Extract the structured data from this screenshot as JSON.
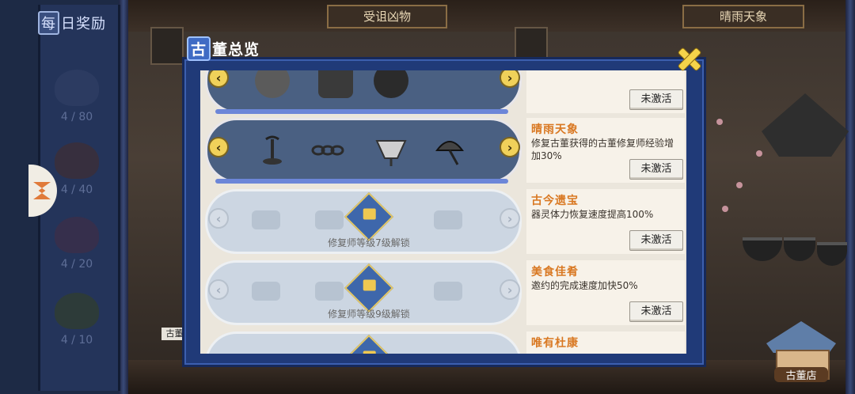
{
  "top_signs": {
    "left": "受诅凶物",
    "right": "晴雨天象"
  },
  "daily_reward": {
    "badge": "每",
    "title": "日奖励",
    "items": [
      {
        "count": "4 / 80"
      },
      {
        "count": "4 / 40"
      },
      {
        "count": "4 / 20"
      },
      {
        "count": "4 / 10"
      }
    ]
  },
  "modal": {
    "title_badge": "古",
    "title": "董总览",
    "rows": [
      {
        "name": "",
        "desc": "",
        "button": "未激活",
        "locked": false,
        "lock_text": ""
      },
      {
        "name": "晴雨天象",
        "desc": "修复古董获得的古董修复师经验增加30%",
        "button": "未激活",
        "locked": false,
        "lock_text": ""
      },
      {
        "name": "古今遗宝",
        "desc": "器灵体力恢复速度提高100%",
        "button": "未激活",
        "locked": true,
        "lock_text": "修复师等级7级解锁"
      },
      {
        "name": "美食佳肴",
        "desc": "邀约的完成速度加快50%",
        "button": "未激活",
        "locked": true,
        "lock_text": "修复师等级9级解锁"
      },
      {
        "name": "唯有杜康",
        "desc": "",
        "button": "",
        "locked": true,
        "lock_text": ""
      }
    ]
  },
  "shop": {
    "label": "古董店"
  },
  "counter_sign": "古董总",
  "colors": {
    "modal_frame": "#203a78",
    "row_name": "#d97822",
    "arrow": "#f0d15a"
  }
}
